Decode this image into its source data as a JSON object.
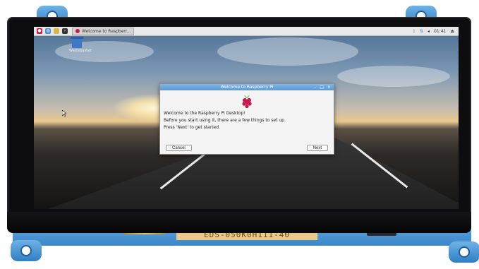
{
  "taskbar": {
    "task_label": "Welcome to Raspberr...",
    "clock": "01:41"
  },
  "desktop": {
    "trash_label": "Wastebasket"
  },
  "dialog": {
    "title": "Welcome to Raspberry Pi",
    "line1": "Welcome to the Raspberry Pi Desktop!",
    "line2": "Before you start using it, there are a few things to set up.",
    "line3": "Press 'Next' to get started.",
    "cancel_label": "Cancel",
    "next_label": "Next"
  },
  "pcb": {
    "label": "EDS-050K0H111-40"
  },
  "colors": {
    "bracket": "#3b86c9",
    "titlebar": "#5b98d4",
    "raspberry": "#c51a4a",
    "leaf": "#6cc04a"
  }
}
